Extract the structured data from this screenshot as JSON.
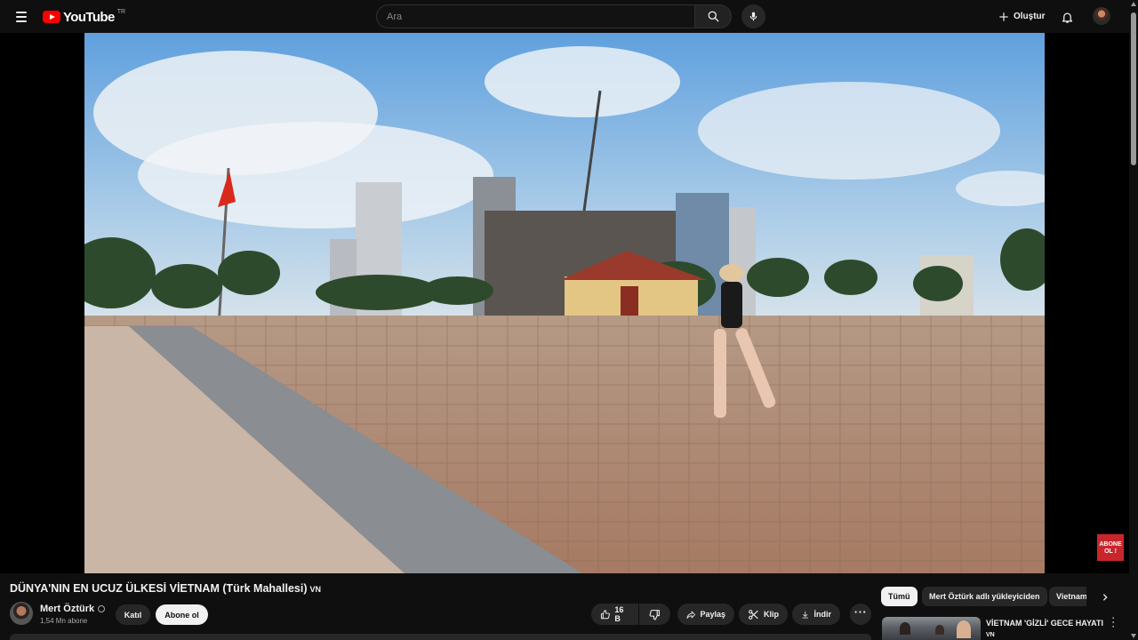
{
  "masthead": {
    "logo_text": "YouTube",
    "country_code": "TR",
    "search_placeholder": "Ara",
    "create_label": "Oluştur"
  },
  "video": {
    "title": "DÜNYA'NIN EN UCUZ ÜLKESİ VİETNAM (Türk Mahallesi)",
    "title_flag": "VN",
    "overlay_badge": [
      "ABONE",
      "OL !"
    ]
  },
  "channel": {
    "name": "Mert Öztürk",
    "subscribers": "1,54 Mn abone",
    "join_label": "Katıl",
    "subscribe_label": "Abone ol"
  },
  "actions": {
    "like_count": "16 B",
    "share_label": "Paylaş",
    "clip_label": "Klip",
    "download_label": "İndir"
  },
  "chips": [
    "Tümü",
    "Mert Öztürk adlı yükleyiciden",
    "Vietnam"
  ],
  "related": [
    {
      "title": "VİETNAM 'GİZLİ' GECE HAYATI",
      "flag": "VN"
    }
  ],
  "icons": {
    "menu": "hamburger-icon",
    "search": "search-icon",
    "mic": "mic-icon",
    "create": "plus-icon",
    "notifications": "bell-icon",
    "like": "thumbs-up-icon",
    "dislike": "thumbs-down-icon",
    "share": "share-arrow-icon",
    "clip": "scissors-icon",
    "download": "download-icon",
    "more": "ellipsis-icon",
    "next": "chevron-right-icon"
  },
  "colors": {
    "background": "#0f0f0f",
    "brand_red": "#ff0000",
    "chip_bg": "#272727",
    "chip_active_bg": "#f1f1f1",
    "badge_red": "#c9262c"
  }
}
